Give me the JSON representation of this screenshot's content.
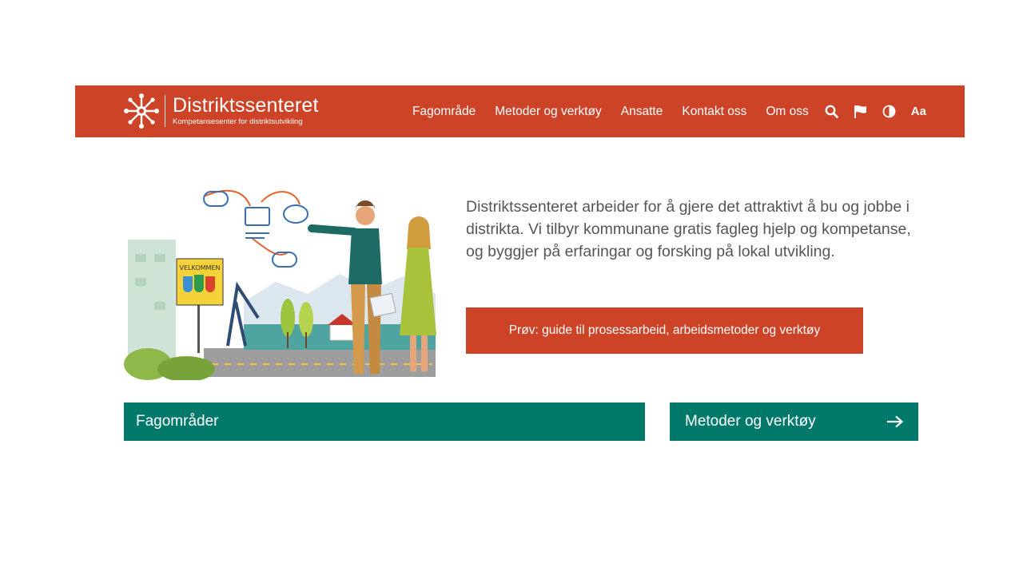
{
  "header": {
    "brand_name": "Distriktssenteret",
    "brand_tagline": "Kompetansesenter for distriktsutvikling",
    "nav": [
      {
        "label": "Fagområde"
      },
      {
        "label": "Metoder og verktøy"
      },
      {
        "label": "Ansatte"
      },
      {
        "label": "Kontakt oss"
      },
      {
        "label": "Om oss"
      }
    ],
    "icons": [
      "search-icon",
      "flag-icon",
      "contrast-icon"
    ],
    "text_size_label": "Aa"
  },
  "hero": {
    "sign_text": "VELKOMMEN",
    "intro": "Distriktssenteret arbeider for å gjere det attraktivt å bu og jobbe i distrikta. Vi tilbyr kommunane gratis fagleg hjelp og kompetanse, og byggjer på erfaringar og forsking på lokal utvikling.",
    "cta_label": "Prøv: guide til prosessarbeid, arbeidsmetoder og verktøy"
  },
  "tiles": {
    "fagomrader": "Fagområder",
    "metoder": "Metoder og verktøy"
  },
  "colors": {
    "brand_red": "#cc4327",
    "teal": "#00796b",
    "text_gray": "#555555"
  }
}
